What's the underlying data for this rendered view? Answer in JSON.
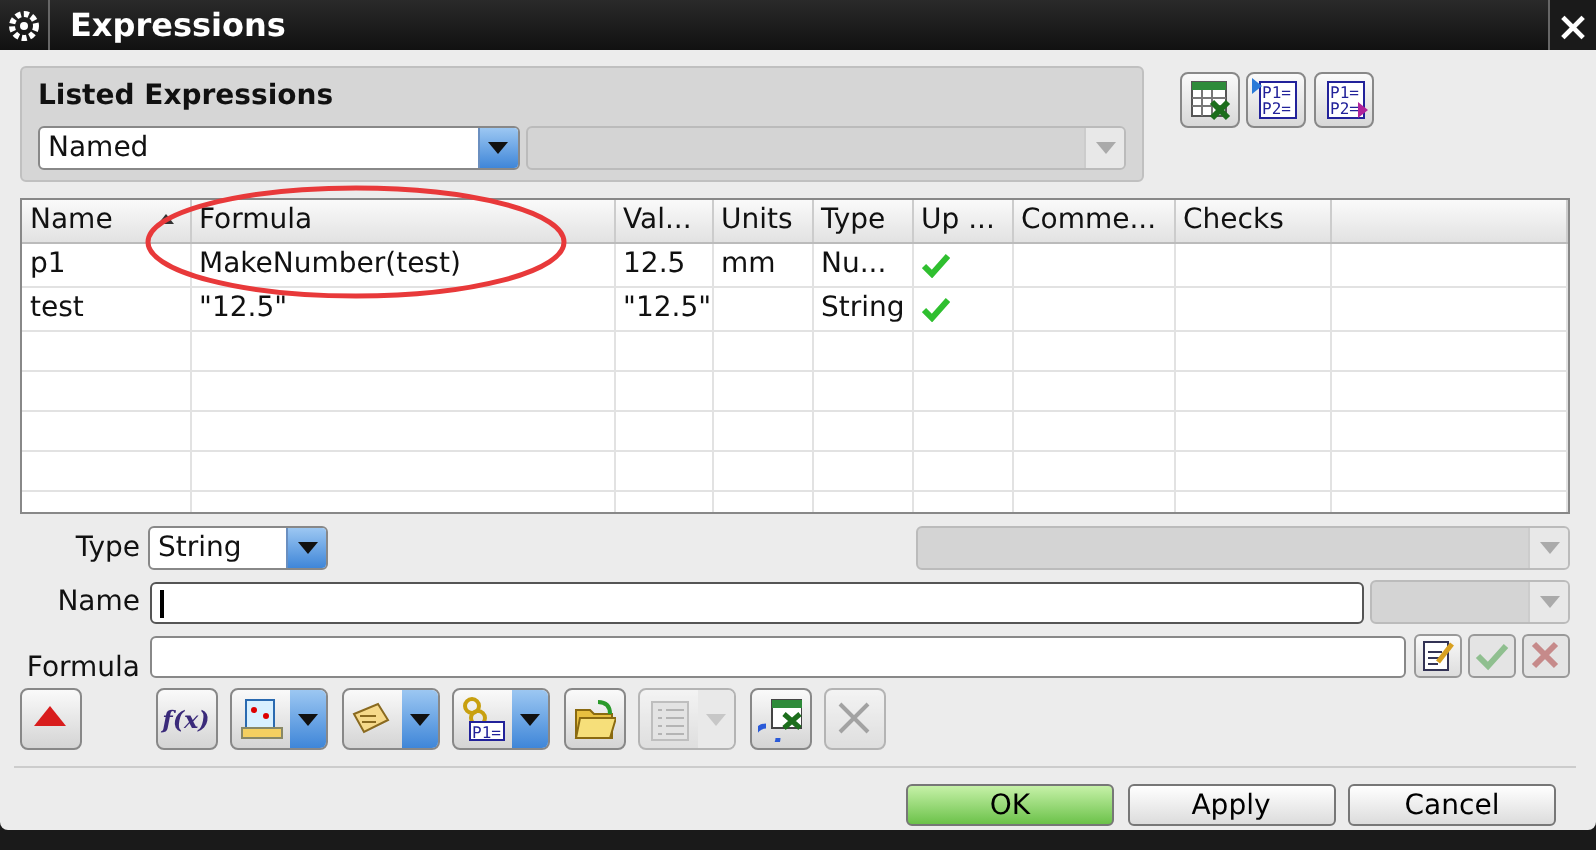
{
  "window": {
    "title": "Expressions",
    "close": "×"
  },
  "listed_expressions": {
    "title": "Listed Expressions",
    "filter": "Named",
    "filter_2": {
      "disabled": true
    }
  },
  "top_tools": [
    {
      "kind": "spreadsheet"
    },
    {
      "kind": "import",
      "text": [
        "P1=",
        "P2="
      ]
    },
    {
      "kind": "export",
      "text": [
        "P1=",
        "P2="
      ]
    }
  ],
  "table": {
    "columns": [
      {
        "label": "Name",
        "sorted": true
      },
      {
        "label": "Formula",
        "sorted": false
      },
      {
        "label": "Val...",
        "sorted": false
      },
      {
        "label": "Units",
        "sorted": false
      },
      {
        "label": "Type",
        "sorted": false
      },
      {
        "label": "Up ...",
        "sorted": false
      },
      {
        "label": "Comme...",
        "sorted": false
      },
      {
        "label": "Checks",
        "sorted": false
      }
    ],
    "rows": [
      {
        "name": "p1",
        "formula": "MakeNumber(test)",
        "value": "12.5",
        "units": "mm",
        "type": "Nu...",
        "up_to_date": true
      },
      {
        "name": "test",
        "formula": "\"12.5\"",
        "value": "\"12.5\"",
        "type": "String",
        "up_to_date": true
      }
    ]
  },
  "annotations": [
    {
      "kind": "ellipse"
    }
  ],
  "type": {
    "label": "Type",
    "value": "String",
    "extra": {
      "disabled": true
    }
  },
  "name": {
    "label": "Name",
    "focused": true,
    "units": {
      "disabled": true
    }
  },
  "formula": {
    "label": "Formula",
    "actions": [
      {
        "kind": "edit",
        "disabled": false
      },
      {
        "kind": "accept",
        "disabled": true
      },
      {
        "kind": "reject",
        "disabled": true
      }
    ]
  },
  "toolbar": [
    {
      "kind": "collapse",
      "dropdown": false,
      "disabled": false
    },
    {
      "kind": "function",
      "text": "f(x)",
      "dropdown": false,
      "disabled": false
    },
    {
      "kind": "measure",
      "dropdown": true,
      "disabled": false
    },
    {
      "kind": "tag",
      "dropdown": true,
      "disabled": false
    },
    {
      "kind": "link",
      "text": "P1=",
      "dropdown": true,
      "disabled": false
    },
    {
      "kind": "folder",
      "dropdown": false,
      "disabled": false
    },
    {
      "kind": "list",
      "dropdown": true,
      "disabled": true
    },
    {
      "kind": "refresh",
      "dropdown": false,
      "disabled": false
    },
    {
      "kind": "delete",
      "dropdown": false,
      "disabled": true
    }
  ],
  "buttons": [
    {
      "label": "OK",
      "default": true
    },
    {
      "label": "Apply",
      "default": false
    },
    {
      "label": "Cancel",
      "default": false
    }
  ]
}
